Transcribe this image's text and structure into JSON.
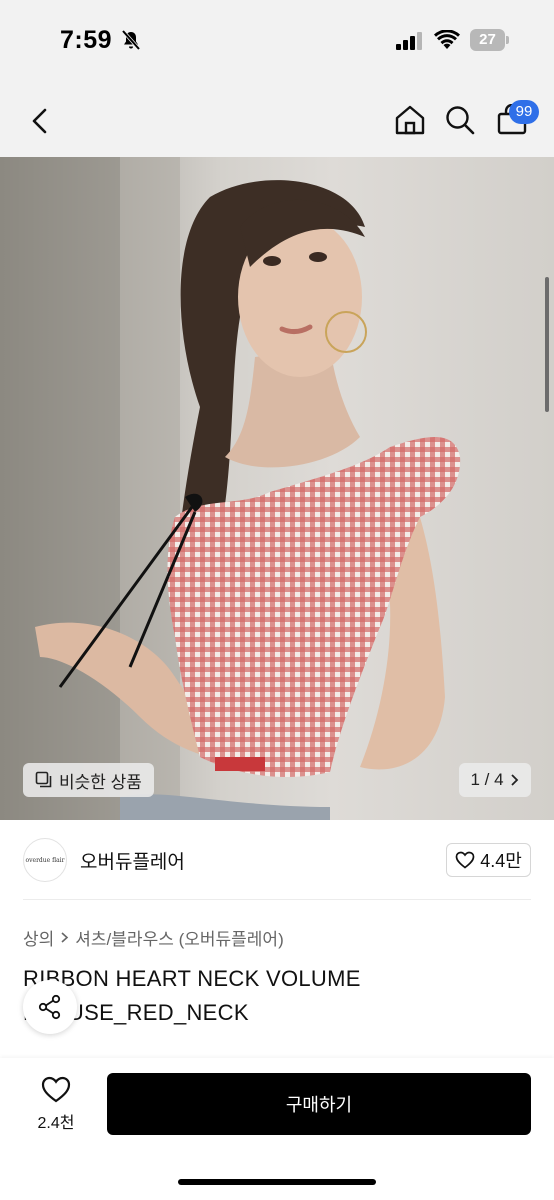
{
  "status_bar": {
    "time": "7:59",
    "battery": "27",
    "icons": [
      "bell-slash-icon",
      "signal-icon",
      "wifi-icon",
      "battery-icon"
    ]
  },
  "header": {
    "icons": [
      "back-icon",
      "home-icon",
      "search-icon",
      "shopping-bag-icon"
    ],
    "cart_badge": "99"
  },
  "gallery": {
    "similar_label": "비슷한 상품",
    "pager": "1 / 4",
    "image": "model-in-red-gingham-blouse-photo"
  },
  "brand": {
    "logo_text": "overdue flair",
    "name": "오버듀플레어",
    "like_count": "4.4만"
  },
  "category": {
    "parent": "상의",
    "child": "셔츠/블라우스 (오버듀플레어)"
  },
  "product": {
    "title": "RIBBON HEART NECK VOLUME BLOUSE_RED_NECK"
  },
  "bottom": {
    "wish_count": "2.4천",
    "buy_label": "구매하기"
  },
  "colors": {
    "badge": "#2f6fe8",
    "buy_button": "#000000",
    "background": "#f2f2f2"
  }
}
